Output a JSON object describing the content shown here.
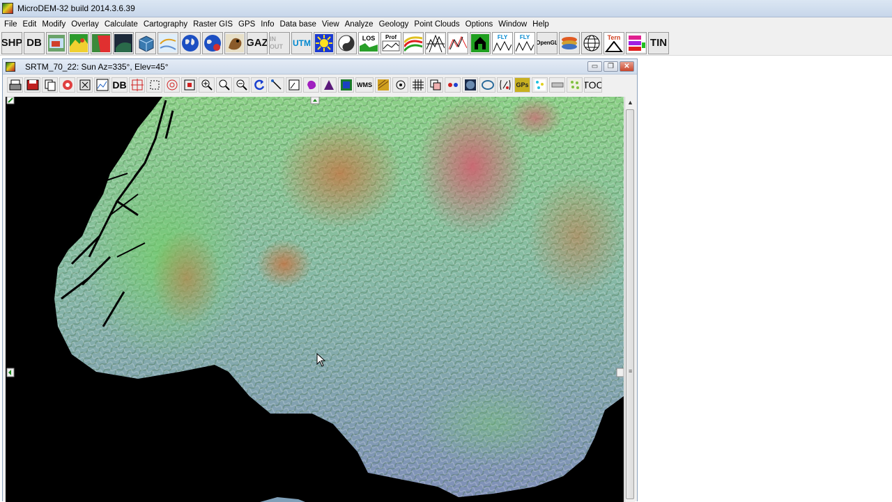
{
  "app": {
    "title": "MicroDEM-32 build 2014.3.6.39"
  },
  "menu": [
    "File",
    "Edit",
    "Modify",
    "Overlay",
    "Calculate",
    "Cartography",
    "Raster GIS",
    "GPS",
    "Info",
    "Data base",
    "View",
    "Analyze",
    "Geology",
    "Point Clouds",
    "Options",
    "Window",
    "Help"
  ],
  "main_toolbar": {
    "shp_label": "SHP",
    "db_label": "DB",
    "gaz_label": "GAZ",
    "inout_label": "IN OUT",
    "utm_label": "UTM",
    "los_label": "LOS",
    "prof_label": "Prof",
    "fly_label": "FLY",
    "opengl_label": "OpenGL",
    "tin_label": "TIN"
  },
  "map_window": {
    "title": "SRTM_70_22: Sun Az=335°, Elev=45°",
    "toolbar": {
      "db_label": "DB",
      "wms_label": "WMS",
      "gps_label": "GPs",
      "toc_label": "TOC"
    }
  },
  "colors": {
    "menubar_bg": "#f0f0f0",
    "map_background": "#000000",
    "hillshade_low": "#7f8fb8",
    "hillshade_mid": "#74c87a",
    "hillshade_high": "#c85a4a"
  }
}
